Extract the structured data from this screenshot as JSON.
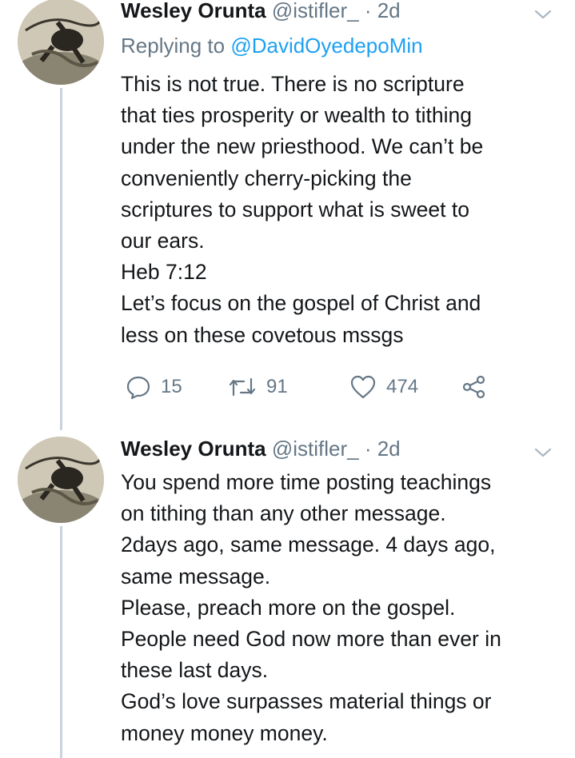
{
  "tweets": [
    {
      "author_name": "Wesley Orunta",
      "handle": "@istifler_",
      "separator": "·",
      "time": "2d",
      "replying_prefix": "Replying to",
      "replying_to": "@DavidOyedepoMin",
      "lines": [
        "This is not true. There is no scripture",
        "that ties prosperity or wealth to tithing",
        "under the new priesthood. We can’t be",
        "conveniently cherry-picking the",
        "scriptures to support what is sweet to",
        "our ears.",
        "Heb 7:12",
        "Let’s focus on the gospel of Christ and",
        "less on these covetous mssgs"
      ],
      "actions": {
        "replies": "15",
        "retweets": "91",
        "likes": "474"
      }
    },
    {
      "author_name": "Wesley Orunta",
      "handle": "@istifler_",
      "separator": "·",
      "time": "2d",
      "lines": [
        "You spend more time posting teachings",
        "on tithing than any other message.",
        "2days ago, same message. 4 days ago,",
        "same message.",
        "Please, preach more on the gospel.",
        "People need God now more than ever in",
        "these last days.",
        "God’s love surpasses material things or",
        "money money money."
      ]
    }
  ],
  "colors": {
    "link": "#1da1f2",
    "secondary": "#657786",
    "thread_line": "#c8d3dc"
  },
  "icons": [
    "reply-icon",
    "retweet-icon",
    "like-icon",
    "share-icon",
    "chevron-down-icon"
  ]
}
